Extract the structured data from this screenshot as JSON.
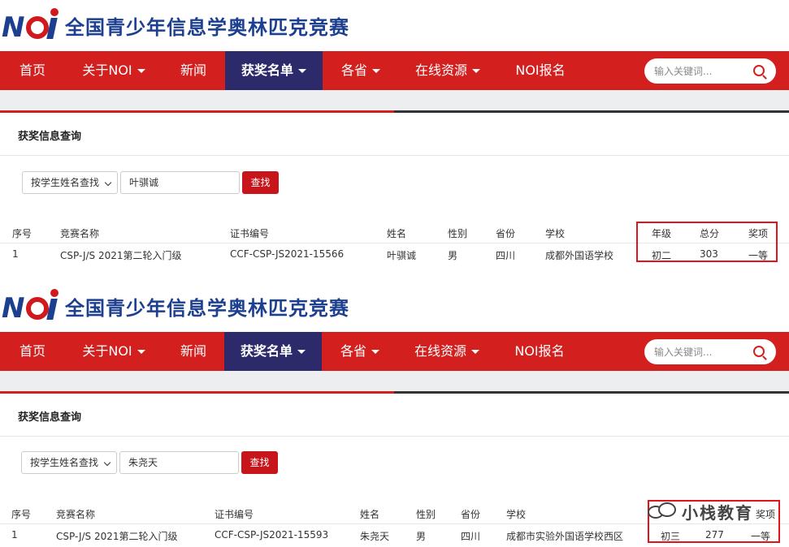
{
  "site": {
    "logo_text": "NOI",
    "title": "全国青少年信息学奥林匹克竞赛"
  },
  "nav": {
    "items": [
      {
        "label": "首页",
        "dropdown": false
      },
      {
        "label": "关于NOI",
        "dropdown": true
      },
      {
        "label": "新闻",
        "dropdown": false
      },
      {
        "label": "获奖名单",
        "dropdown": true,
        "active": true
      },
      {
        "label": "各省",
        "dropdown": true
      },
      {
        "label": "在线资源",
        "dropdown": true
      },
      {
        "label": "NOI报名",
        "dropdown": false
      }
    ],
    "search_placeholder": "输入关键词..."
  },
  "section_title": "获奖信息查询",
  "query": {
    "select_value": "按学生姓名查找",
    "button_label": "查找"
  },
  "table_headers": [
    "序号",
    "竞赛名称",
    "证书编号",
    "姓名",
    "性别",
    "省份",
    "学校",
    "年级",
    "总分",
    "奖项"
  ],
  "results": [
    {
      "search_value": "叶骐诚",
      "row": [
        "1",
        "CSP-J/S 2021第二轮入门级",
        "CCF-CSP-JS2021-15566",
        "叶骐诚",
        "男",
        "四川",
        "成都外国语学校",
        "初二",
        "303",
        "一等"
      ]
    },
    {
      "search_value": "朱尧天",
      "row": [
        "1",
        "CSP-J/S 2021第二轮入门级",
        "CCF-CSP-JS2021-15593",
        "朱尧天",
        "男",
        "四川",
        "成都市实验外国语学校西区",
        "初三",
        "277",
        "一等"
      ]
    }
  ],
  "watermark": "小栈教育",
  "colors": {
    "nav_red": "#d3201f",
    "nav_active": "#2c2a6b",
    "brand_blue": "#1c3f8f",
    "button_red": "#c8151b",
    "highlight_box": "#e0141b"
  }
}
